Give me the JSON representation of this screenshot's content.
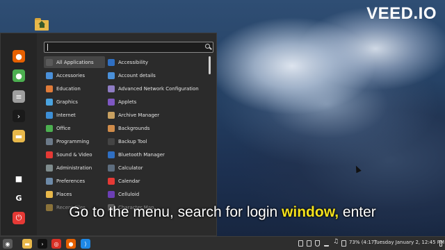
{
  "watermark": "VEED.IO",
  "caption": {
    "part1": "Go to the menu, search for login ",
    "highlight": "window,",
    "part2": " enter"
  },
  "search": {
    "value": "",
    "placeholder": ""
  },
  "categories": [
    {
      "label": "All Applications",
      "icon": "grid-icon",
      "color": "#5a5a5a"
    },
    {
      "label": "Accessories",
      "icon": "scissors-icon",
      "color": "#4a90d9"
    },
    {
      "label": "Education",
      "icon": "education-icon",
      "color": "#e07b39"
    },
    {
      "label": "Graphics",
      "icon": "graphics-icon",
      "color": "#4aa3df"
    },
    {
      "label": "Internet",
      "icon": "cloud-icon",
      "color": "#3d8fd6"
    },
    {
      "label": "Office",
      "icon": "office-icon",
      "color": "#4caf50"
    },
    {
      "label": "Programming",
      "icon": "code-icon",
      "color": "#6c7a89"
    },
    {
      "label": "Sound & Video",
      "icon": "play-icon",
      "color": "#e53935"
    },
    {
      "label": "Administration",
      "icon": "admin-icon",
      "color": "#7f8c8d"
    },
    {
      "label": "Preferences",
      "icon": "preferences-icon",
      "color": "#6d8aa8"
    },
    {
      "label": "Places",
      "icon": "folder-icon",
      "color": "#e8b84a"
    },
    {
      "label": "Recent Files",
      "icon": "recent-icon",
      "color": "#e8b84a"
    }
  ],
  "apps": [
    {
      "label": "Accessibility",
      "icon": "accessibility-icon",
      "color": "#2f6fc2"
    },
    {
      "label": "Account details",
      "icon": "account-icon",
      "color": "#4a90d9"
    },
    {
      "label": "Advanced Network Configuration",
      "icon": "network-icon",
      "color": "#8e7cc3"
    },
    {
      "label": "Applets",
      "icon": "applets-icon",
      "color": "#7e57c2"
    },
    {
      "label": "Archive Manager",
      "icon": "archive-icon",
      "color": "#c8a060"
    },
    {
      "label": "Backgrounds",
      "icon": "backgrounds-icon",
      "color": "#d08c4a"
    },
    {
      "label": "Backup Tool",
      "icon": "backup-icon",
      "color": "#444444"
    },
    {
      "label": "Bluetooth Manager",
      "icon": "bluetooth-icon",
      "color": "#2f6fc2"
    },
    {
      "label": "Calculator",
      "icon": "calculator-icon",
      "color": "#5d6d7e"
    },
    {
      "label": "Calendar",
      "icon": "calendar-icon",
      "color": "#e53935"
    },
    {
      "label": "Celluloid",
      "icon": "celluloid-icon",
      "color": "#6c3fb5"
    },
    {
      "label": "Character Map",
      "icon": "charmap-icon",
      "color": "#9e9e9e"
    }
  ],
  "sidebar": [
    {
      "name": "firefox-icon",
      "color": "#e66000",
      "glyph": "●"
    },
    {
      "name": "software-manager-icon",
      "color": "#4caf50",
      "glyph": "●"
    },
    {
      "name": "system-settings-icon",
      "color": "#9e9e9e",
      "glyph": "≡"
    },
    {
      "name": "terminal-icon",
      "color": "#1a1a1a",
      "glyph": "›"
    },
    {
      "name": "files-icon",
      "color": "#e8b84a",
      "glyph": "▬"
    },
    {
      "name": "lock-screen-icon",
      "color": "transparent",
      "glyph": "■"
    },
    {
      "name": "logout-icon",
      "color": "transparent",
      "glyph": "G"
    },
    {
      "name": "shutdown-icon",
      "color": "#e53935",
      "glyph": "⏻"
    }
  ],
  "panel": {
    "tasks": [
      {
        "name": "mint-menu-icon",
        "color": "#5a5a5a",
        "glyph": "◉"
      },
      {
        "name": "files-icon",
        "color": "#e8b84a",
        "glyph": "▬"
      },
      {
        "name": "terminal-icon",
        "color": "#111111",
        "glyph": "›"
      },
      {
        "name": "chrome-icon",
        "color": "#d93025",
        "glyph": "◎"
      },
      {
        "name": "firefox-icon",
        "color": "#e66000",
        "glyph": "●"
      },
      {
        "name": "vscode-icon",
        "color": "#1e88e5",
        "glyph": "⟩"
      }
    ],
    "battery": "73% (4:17)",
    "clock": "Tuesday January 2, 12:45 PM"
  }
}
